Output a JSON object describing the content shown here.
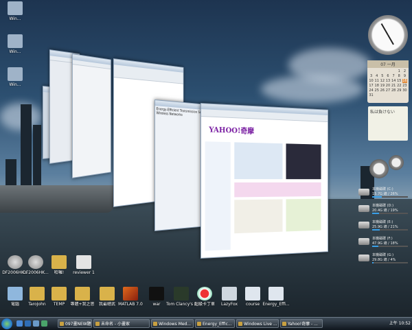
{
  "desktop_icons": [
    {
      "label": "Win..."
    },
    {
      "label": "Win..."
    },
    {
      "label": "Win..."
    },
    {
      "label": "DF2006HK..."
    },
    {
      "label": "DF2006HK..."
    },
    {
      "label": "哈囉!"
    },
    {
      "label": "reviewer 1"
    },
    {
      "label": "電腦"
    },
    {
      "label": "TaroJohn"
    },
    {
      "label": "TEMP"
    },
    {
      "label": "專題+我之思"
    },
    {
      "label": "我最聰武"
    },
    {
      "label": "MATLAB 7.0"
    },
    {
      "label": "war"
    },
    {
      "label": "Tom Clancy's S..."
    },
    {
      "label": "超級卡丁車"
    },
    {
      "label": "LazyFox"
    },
    {
      "label": "course"
    },
    {
      "label": "Energy_Effi..."
    }
  ],
  "windows": {
    "doc_title": "Energy-Efficient Transmission Scheduling for Wireless Networks",
    "browser_site": "YAHOO!奇摩"
  },
  "gadgets": {
    "calendar_month": "07 一月",
    "calendar_days": [
      "",
      "",
      "",
      "",
      "",
      "1",
      "2",
      "3",
      "4",
      "5",
      "6",
      "7",
      "8",
      "9",
      "10",
      "11",
      "12",
      "13",
      "14",
      "15",
      "16",
      "17",
      "18",
      "19",
      "20",
      "21",
      "22",
      "23",
      "24",
      "25",
      "26",
      "27",
      "28",
      "29",
      "30",
      "31"
    ],
    "calendar_today": "16",
    "note_text": "私は負けない",
    "drives": [
      {
        "name": "本機磁碟 (C:)",
        "info": "15.7G 總 / 26%",
        "pct": 26
      },
      {
        "name": "本機磁碟 (D:)",
        "info": "20.4G 總 / 19%",
        "pct": 19
      },
      {
        "name": "本機磁碟 (E:)",
        "info": "25.9G 總 / 21%",
        "pct": 21
      },
      {
        "name": "本機磁碟 (F:)",
        "info": "47.9G 總 / 18%",
        "pct": 18
      },
      {
        "name": "本機磁碟 (G:)",
        "info": "29.8G 總 / 4%",
        "pct": 4
      }
    ]
  },
  "taskbar": {
    "tasks": [
      {
        "label": "097畫NEW題..."
      },
      {
        "label": "未命名 - 小畫家"
      },
      {
        "label": "Windows Med..."
      },
      {
        "label": "Energy_Effic..."
      },
      {
        "label": "Windows Live ..."
      },
      {
        "label": "Yahoo!奇摩 - ..."
      }
    ],
    "clock": "上午 10:52"
  }
}
